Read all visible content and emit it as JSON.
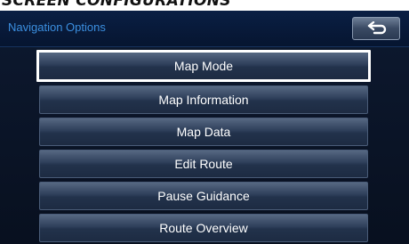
{
  "caption": "SCREEN CONFIGURATIONS",
  "header": {
    "title": "Navigation Options",
    "back_icon": "return-arrow-icon"
  },
  "menu": {
    "selected_index": 0,
    "items": [
      {
        "label": "Map Mode"
      },
      {
        "label": "Map Information"
      },
      {
        "label": "Map Data"
      },
      {
        "label": "Edit Route"
      },
      {
        "label": "Pause Guidance"
      },
      {
        "label": "Route Overview"
      }
    ]
  },
  "colors": {
    "header_title": "#3b8fe0",
    "selection_outline": "#ffffff",
    "button_text": "#ffffff"
  }
}
